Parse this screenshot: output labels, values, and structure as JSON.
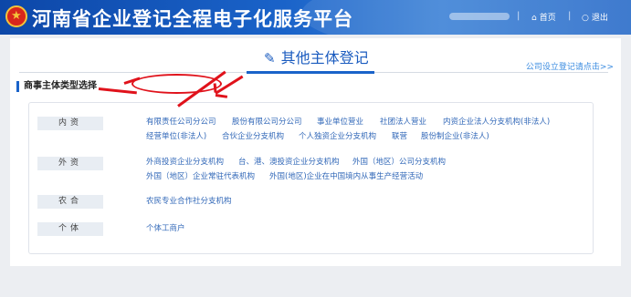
{
  "header": {
    "title": "河南省企业登记全程电子化服务平台",
    "emblem_icon": "national-emblem-icon",
    "home_label": "首页",
    "home_icon": "home-icon",
    "logout_label": "退出",
    "logout_icon": "power-icon",
    "separator": "|"
  },
  "main": {
    "tab_title": "其他主体登记",
    "tab_icon": "edit-icon",
    "corp_link": "公司设立登记请点击>>",
    "section_title": "商事主体类型选择"
  },
  "categories": [
    {
      "label": "内资",
      "rows": [
        [
          "有限责任公司分公司",
          "股份有限公司分公司",
          "事业单位营业",
          "社团法人营业",
          "内资企业法人分支机构(非法人)"
        ],
        [
          "经营单位(非法人)",
          "合伙企业分支机构",
          "个人独资企业分支机构",
          "联营",
          "股份制企业(非法人)"
        ]
      ]
    },
    {
      "label": "外资",
      "rows": [
        [
          "外商投资企业分支机构",
          "台、港、澳投资企业分支机构",
          "外国（地区）公司分支机构"
        ],
        [
          "外国（地区）企业常驻代表机构",
          "外国(地区)企业在中国境内从事生产经营活动"
        ]
      ]
    },
    {
      "label": "农合",
      "rows": [
        [
          "农民专业合作社分支机构"
        ]
      ]
    },
    {
      "label": "个体",
      "rows": [
        [
          "个体工商户"
        ]
      ]
    }
  ],
  "annotations": {
    "color": "#e0121b",
    "highlighted_item": "有限责任公司分公司"
  },
  "colors": {
    "header": "#1a63c9",
    "link": "#3268b8",
    "accent": "#1a63c9"
  }
}
